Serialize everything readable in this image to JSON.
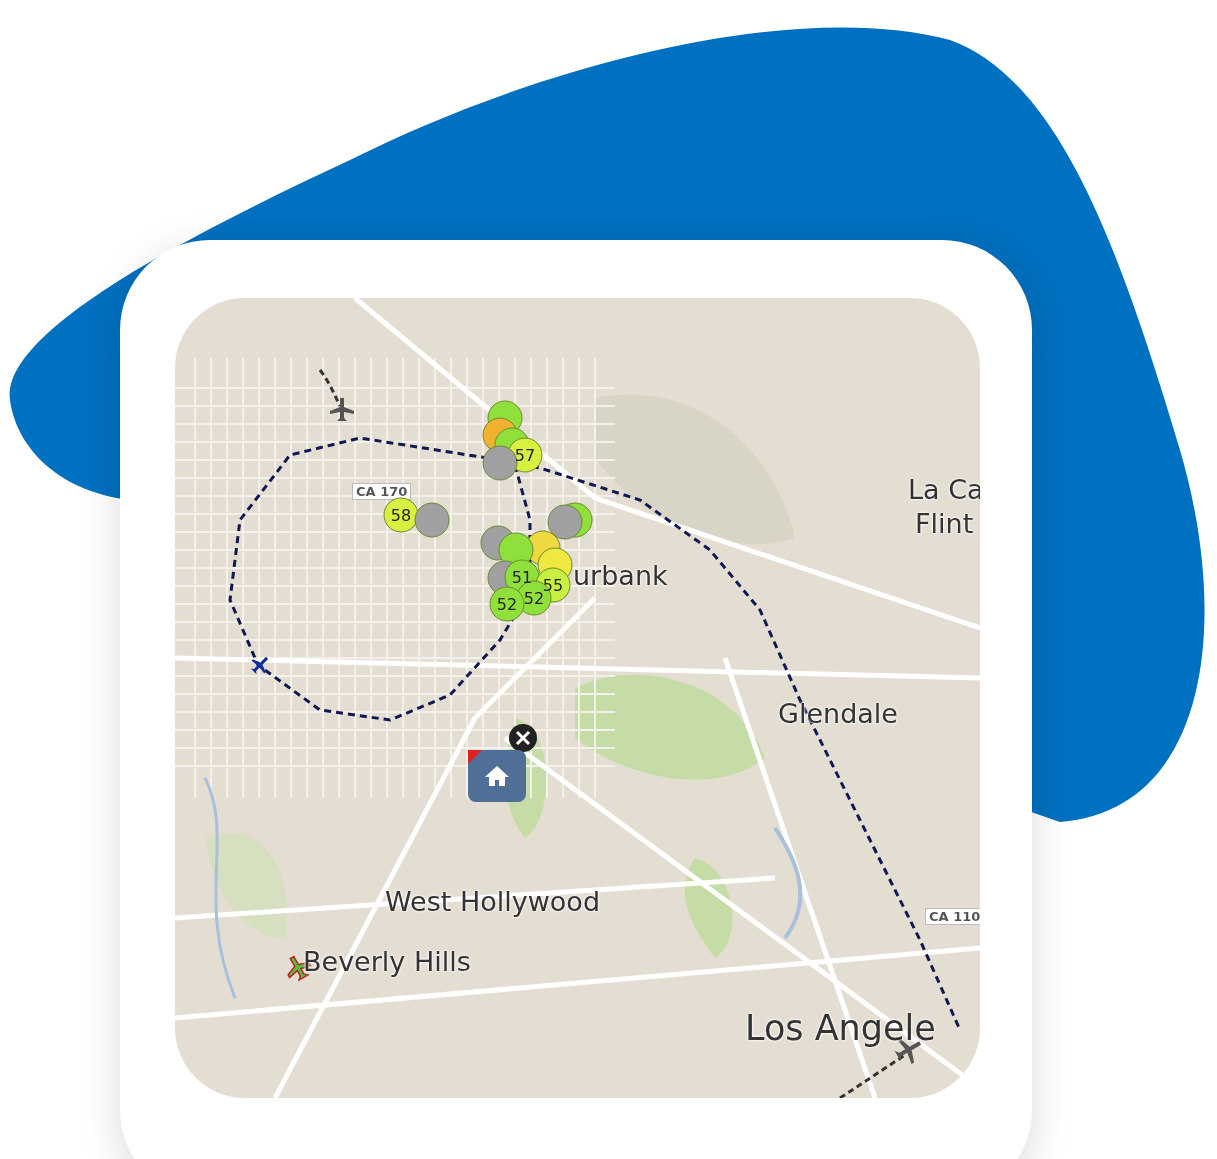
{
  "map": {
    "labels": [
      {
        "text": "La Ca",
        "kind": "city"
      },
      {
        "text": "Flint",
        "kind": "city"
      },
      {
        "text": "CA 170",
        "kind": "road"
      },
      {
        "text": "urbank",
        "kind": "city"
      },
      {
        "text": "Glendale",
        "kind": "city"
      },
      {
        "text": "West Hollywood",
        "kind": "city"
      },
      {
        "text": "Beverly Hills",
        "kind": "city"
      },
      {
        "text": "CA 110",
        "kind": "road"
      },
      {
        "text": "Los Angele",
        "kind": "big"
      }
    ],
    "markers": [
      {
        "color": "#8fe03a"
      },
      {
        "color": "#f0b030"
      },
      {
        "color": "#8fe03a"
      },
      {
        "label": "57",
        "color": "#d8f040"
      },
      {
        "color": "#a0a0a0"
      },
      {
        "label": "58",
        "color": "#d8f040"
      },
      {
        "color": "#a0a0a0"
      },
      {
        "color": "#8fe03a"
      },
      {
        "color": "#a0a0a0"
      },
      {
        "color": "#a0a0a0"
      },
      {
        "color": "#f0d840"
      },
      {
        "color": "#8fe03a"
      },
      {
        "color": "#f0e840"
      },
      {
        "color": "#a0a0a0"
      },
      {
        "label": "51",
        "color": "#8fe03a"
      },
      {
        "label": "55",
        "color": "#c8f040"
      },
      {
        "label": "52",
        "color": "#8fe03a"
      },
      {
        "label": "52",
        "color": "#8fe03a"
      }
    ]
  }
}
